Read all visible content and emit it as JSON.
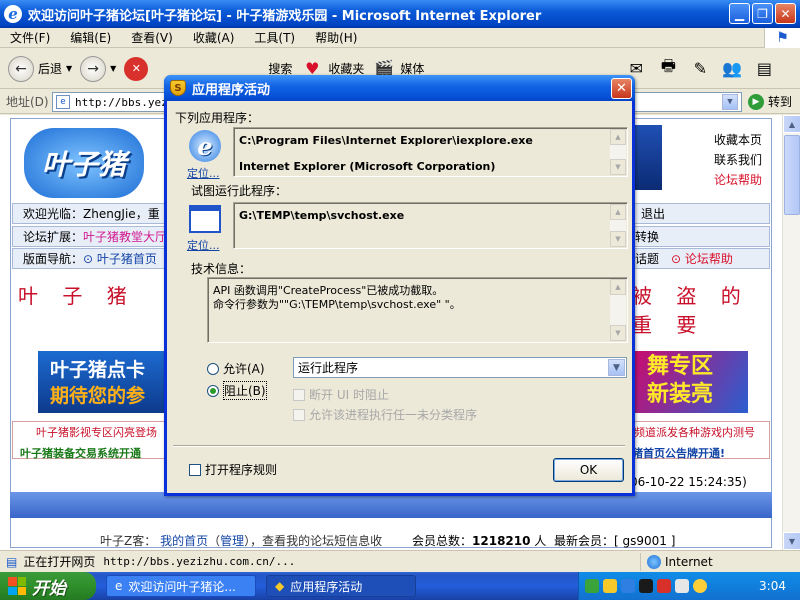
{
  "browser": {
    "title": "欢迎访问叶子猪论坛[叶子猪论坛] - 叶子猪游戏乐园 - Microsoft Internet Explorer",
    "menu": [
      "文件(F)",
      "编辑(E)",
      "查看(V)",
      "收藏(A)",
      "工具(T)",
      "帮助(H)"
    ],
    "toolbar": {
      "back": "后退",
      "search": "搜索",
      "favorites": "收藏夹",
      "media": "媒体"
    },
    "address_label": "地址(D)",
    "address_value": "http://bbs.yezi",
    "go": "转到",
    "status_text": "正在打开网页",
    "status_url": "http://bbs.yezizhu.com.cn/...",
    "zone": "Internet"
  },
  "site": {
    "logo": "叶子猪",
    "right_links": [
      "收藏本页",
      "联系我们",
      "论坛帮助"
    ],
    "welcome_prefix": "欢迎光临：ZhengJie，重",
    "logout": "退出",
    "ext_label": "论坛扩展：",
    "ext_link": "叶子猪教堂大厅",
    "switch": "转换",
    "nav_label": "版面导航：",
    "nav_home": "叶子猪首页",
    "nav_topic": "话题",
    "nav_help": "论坛帮助",
    "marquee_left": "叶 子 猪 （ 上",
    "marquee_right": "被 盗 的 重 要",
    "ad_left_1": "叶子猪点卡",
    "ad_left_2": "期待您的参",
    "ad_right_1": "舞专区",
    "ad_right_2": "新装亮",
    "news_1": "叶子猪影视专区闪亮登场",
    "news_2": "叶子猪装备交易系统开通",
    "news_3": "频道派发各种游戏内测号",
    "news_4": "猪首页公告牌开通!",
    "timestamp": "06-10-22 15:24:35)",
    "user_line_prefix": "叶子Z客：",
    "user_home": "我的首页",
    "user_manage": "管理",
    "user_line_suffix": "，查看我的论坛短信息收",
    "members_label": "会员总数：",
    "members_count": "1218210",
    "members_unit": "人",
    "newest_label": "最新会员：[",
    "newest_name": "gs9001",
    "newest_close": "]"
  },
  "dialog": {
    "title": "应用程序活动",
    "app_label": "下列应用程序：",
    "app_path": "C:\\Program Files\\Internet Explorer\\iexplore.exe",
    "app_desc": "Internet Explorer (Microsoft Corporation)",
    "locate": "定位...",
    "target_label": "试图运行此程序：",
    "target_path": "G:\\TEMP\\temp\\svchost.exe",
    "tech_label": "技术信息：",
    "tech_line_1": "API 函数调用\"CreateProcess\"已被成功截取。",
    "tech_line_2": "命令行参数为\"\"G:\\TEMP\\temp\\svchost.exe\" \"。",
    "allow": "允许(A)",
    "block": "阻止(B)",
    "action_value": "运行此程序",
    "opt_1": "断开 UI 时阻止",
    "opt_2": "允许该进程执行任一未分类程序",
    "open_rules": "打开程序规则",
    "ok": "OK"
  },
  "taskbar": {
    "start": "开始",
    "task_1": "欢迎访问叶子猪论...",
    "task_2": "应用程序活动",
    "clock": "3:04"
  },
  "colors": {
    "accent": "#0054e3",
    "link": "#1244a6",
    "alert": "#d8102a"
  }
}
